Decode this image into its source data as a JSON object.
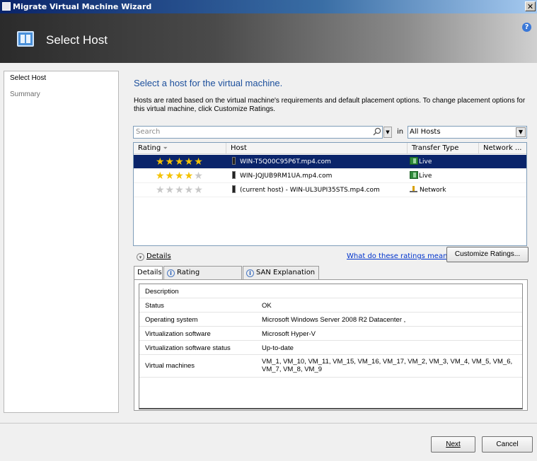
{
  "window": {
    "title": "Migrate Virtual Machine Wizard",
    "close_glyph": "✕"
  },
  "header": {
    "title": "Select Host",
    "help_glyph": "?"
  },
  "sidebar": {
    "items": [
      {
        "label": "Select Host"
      },
      {
        "label": "Summary"
      }
    ]
  },
  "main": {
    "heading": "Select a host for the virtual machine.",
    "description": "Hosts are rated based on the virtual machine's requirements and default placement options. To change placement options for this virtual machine, click Customize Ratings."
  },
  "search": {
    "placeholder": "Search",
    "in_label": "in",
    "scope": "All Hosts"
  },
  "grid": {
    "columns": [
      "Rating",
      "Host",
      "Transfer Type",
      "Network ..."
    ],
    "rows": [
      {
        "stars": 5,
        "host": "WIN-T5Q00C95P6T.mp4.com",
        "transfer": "Live",
        "transfer_icon": "live-migration-icon",
        "selected": true
      },
      {
        "stars": 4,
        "host": "WIN-JQJUB9RM1UA.mp4.com",
        "transfer": "Live",
        "transfer_icon": "live-migration-icon",
        "selected": false
      },
      {
        "stars": 0,
        "host": "(current host) - WIN-UL3UPI35STS.mp4.com",
        "transfer": "Network",
        "transfer_icon": "network-icon",
        "selected": false
      }
    ]
  },
  "details": {
    "toggle_label": "Details",
    "ratings_link": "What do these ratings mean?",
    "customize_button": "Customize Ratings...",
    "tabs": [
      {
        "label": "Details"
      },
      {
        "label": "Rating Explanation"
      },
      {
        "label": "SAN Explanation"
      }
    ],
    "properties": [
      {
        "key": "Description",
        "value": ""
      },
      {
        "key": "Status",
        "value": "OK"
      },
      {
        "key": "Operating system",
        "value": "Microsoft Windows Server 2008 R2 Datacenter ,"
      },
      {
        "key": "Virtualization software",
        "value": "Microsoft Hyper-V"
      },
      {
        "key": "Virtualization software status",
        "value": "Up-to-date"
      },
      {
        "key": "Virtual machines",
        "value": "VM_1, VM_10, VM_11, VM_15, VM_16, VM_17, VM_2, VM_3, VM_4, VM_5, VM_6, VM_7, VM_8, VM_9"
      }
    ]
  },
  "buttons": {
    "next": "Next",
    "cancel": "Cancel"
  }
}
